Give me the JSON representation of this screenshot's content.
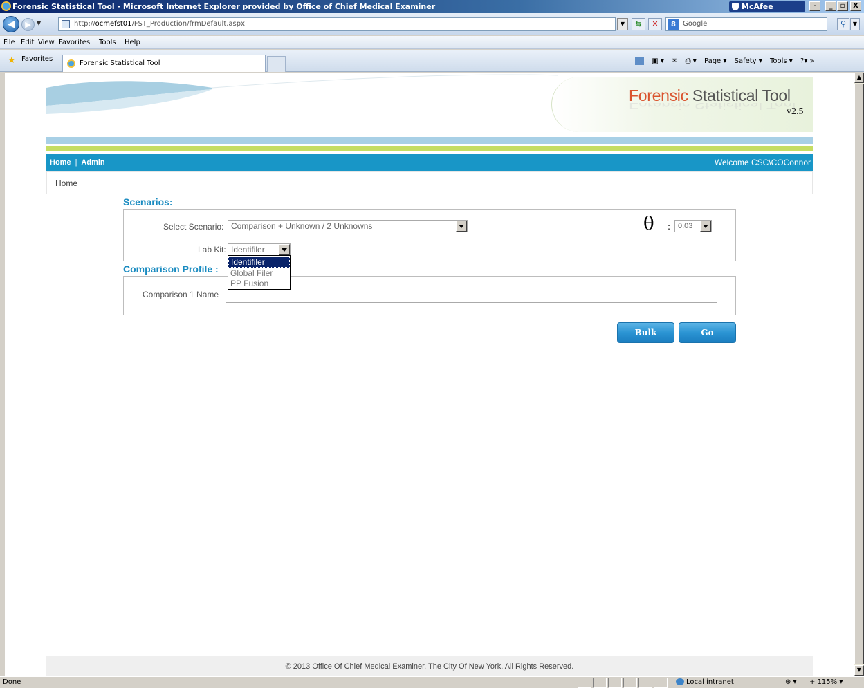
{
  "window": {
    "title": "Forensic Statistical Tool - Microsoft Internet Explorer provided by Office of Chief Medical Examiner",
    "mcafee_label": "McAfee",
    "controls": [
      "-",
      "_",
      "▫",
      "X"
    ]
  },
  "browser": {
    "url_prefix": "http://",
    "url_host": "ocmefst01",
    "url_path": "/FST_Production/frmDefault.aspx",
    "search_placeholder": "Google",
    "search_engine_badge": "8",
    "menu": [
      "File",
      "Edit",
      "View",
      "Favorites",
      "Tools",
      "Help"
    ],
    "favorites_label": "Favorites",
    "tab_title": "Forensic Statistical Tool",
    "commands": [
      "Page ▾",
      "Safety ▾",
      "Tools ▾"
    ]
  },
  "app": {
    "logo_first": "Forensic",
    "logo_rest": " Statistical Tool",
    "version": "v2.5",
    "nav": {
      "home": "Home",
      "separator": "|",
      "admin": "Admin"
    },
    "welcome": "Welcome CSC\\COConnor",
    "breadcrumb": "Home"
  },
  "scenarios": {
    "title": "Scenarios:",
    "select_scenario_label": "Select Scenario:",
    "select_scenario_value": "Comparison + Unknown / 2 Unknowns",
    "theta_symbol": "θ",
    "theta_colon": ":",
    "theta_value": "0.03",
    "lab_kit_label": "Lab Kit:",
    "lab_kit_value": "Identifiler",
    "lab_kit_options": [
      "Identifiler",
      "Global Filer",
      "PP Fusion"
    ],
    "lab_kit_highlighted": "Identifiler"
  },
  "comparison": {
    "title": "Comparison Profile :",
    "name_label": "Comparison 1 Name",
    "name_value": ""
  },
  "actions": {
    "bulk": "Bulk",
    "go": "Go"
  },
  "footer": "© 2013 Office Of Chief Medical Examiner. The City Of New York. All Rights Reserved.",
  "status": {
    "left": "Done",
    "zone": "Local intranet",
    "zoom": "115%"
  },
  "colors": {
    "nav_blue": "#1896c7",
    "section_blue": "#1a8bc0",
    "band_blue": "#a8d0e6",
    "band_green": "#c5dd63",
    "logo_orange": "#d9532e",
    "button_blue": "#2b94d3"
  }
}
